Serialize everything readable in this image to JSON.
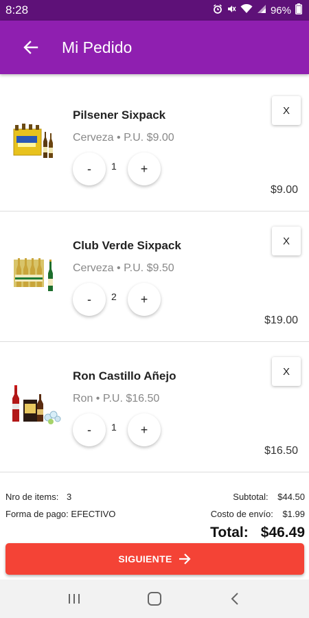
{
  "status_bar": {
    "time": "8:28",
    "battery": "96%",
    "icons": [
      "alarm-icon",
      "mute-icon",
      "wifi-icon",
      "signal-icon",
      "battery-icon"
    ]
  },
  "app_bar": {
    "title": "Mi Pedido",
    "back_icon": "arrow-back-icon"
  },
  "colors": {
    "status_bar": "#5e1178",
    "app_bar": "#8f1fb0",
    "primary_button": "#f44336"
  },
  "order_items": [
    {
      "name": "Pilsener Sixpack",
      "meta": "Cerveza • P.U. $9.00",
      "quantity": "1",
      "total": "$9.00",
      "minus_label": "-",
      "plus_label": "+",
      "remove_label": "X",
      "image": "beer-sixpack-yellow-image"
    },
    {
      "name": "Club Verde Sixpack",
      "meta": "Cerveza • P.U. $9.50",
      "quantity": "2",
      "total": "$19.00",
      "minus_label": "-",
      "plus_label": "+",
      "remove_label": "X",
      "image": "beer-sixpack-green-image"
    },
    {
      "name": "Ron Castillo Añejo",
      "meta": "Ron • P.U. $16.50",
      "quantity": "1",
      "total": "$16.50",
      "minus_label": "-",
      "plus_label": "+",
      "remove_label": "X",
      "image": "rum-combo-image"
    }
  ],
  "summary": {
    "items_label": "Nro de items:",
    "items_count": "3",
    "payment_label": "Forma de pago:",
    "payment_value": "EFECTIVO",
    "subtotal_label": "Subtotal:",
    "subtotal_value": "$44.50",
    "shipping_label": "Costo de envío:",
    "shipping_value": "$1.99",
    "total_label": "Total:",
    "total_value": "$46.49"
  },
  "next_button": {
    "label": "SIGUIENTE",
    "icon": "arrow-forward-icon"
  },
  "nav_bar": {
    "recent_icon": "recent-apps-icon",
    "home_icon": "home-icon",
    "back_icon": "back-chevron-icon"
  }
}
